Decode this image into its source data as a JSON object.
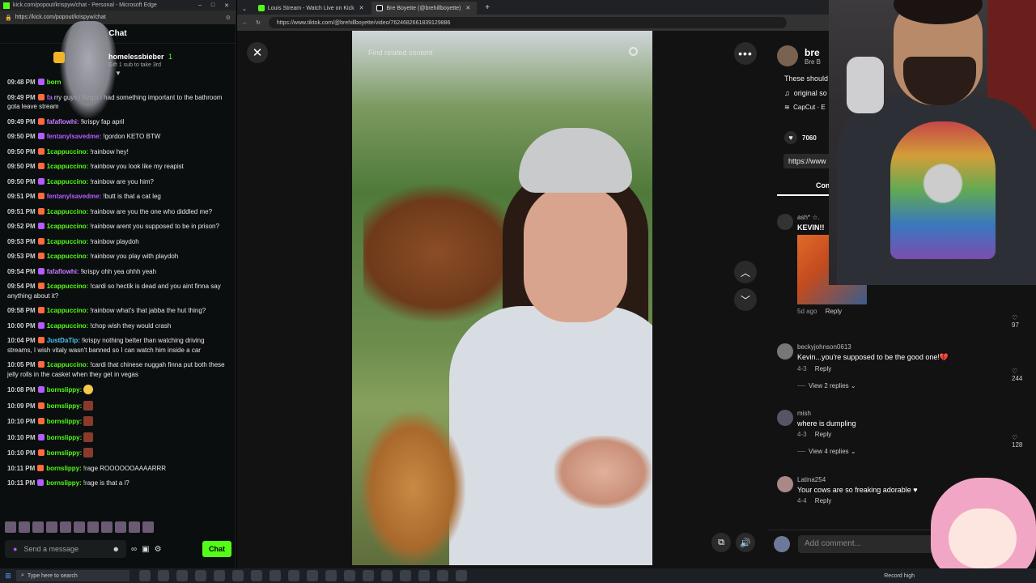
{
  "chat_window": {
    "title": "kick.com/popout/krispyw/chat - Personal - Microsoft Edge",
    "url": "https://kick.com/popout/krispyw/chat",
    "header": "Chat",
    "gift": {
      "user": "homelessbieber",
      "count": "1",
      "subtitle": "Gift 1 sub to take 3rd"
    },
    "messages": [
      {
        "ts": "09:48 PM",
        "user": "born",
        "color": "#53fc18",
        "text": ""
      },
      {
        "ts": "09:49 PM",
        "user": "fa",
        "color": "#b45cff",
        "text": "rry guys i forgot i had something important to the bathroom gota leave stream"
      },
      {
        "ts": "09:49 PM",
        "user": "fafaflowhi:",
        "color": "#c77dff",
        "text": "!krispy fap april"
      },
      {
        "ts": "09:50 PM",
        "user": "fentanylsavedme:",
        "color": "#b45cff",
        "text": "!gordon KETO BTW"
      },
      {
        "ts": "09:50 PM",
        "user": "1cappuccino:",
        "color": "#53fc18",
        "text": "!rainbow hey!"
      },
      {
        "ts": "09:50 PM",
        "user": "1cappuccino:",
        "color": "#53fc18",
        "text": "!rainbow you look like my reapist"
      },
      {
        "ts": "09:50 PM",
        "user": "1cappuccino:",
        "color": "#53fc18",
        "text": "!rainbow are you him?"
      },
      {
        "ts": "09:51 PM",
        "user": "fentanylsavedme:",
        "color": "#b45cff",
        "text": "!butt is that a cat leg"
      },
      {
        "ts": "09:51 PM",
        "user": "1cappuccino:",
        "color": "#53fc18",
        "text": "!rainbow are you the one who diddled me?"
      },
      {
        "ts": "09:52 PM",
        "user": "1cappuccino:",
        "color": "#53fc18",
        "text": "!rainbow arent you supposed to be in prison?"
      },
      {
        "ts": "09:53 PM",
        "user": "1cappuccino:",
        "color": "#53fc18",
        "text": "!rainbow playdoh"
      },
      {
        "ts": "09:53 PM",
        "user": "1cappuccino:",
        "color": "#53fc18",
        "text": "!rainbow you play with playdoh"
      },
      {
        "ts": "09:54 PM",
        "user": "fafaflowhi:",
        "color": "#c77dff",
        "text": "!krispy ohh yea ohhh yeah"
      },
      {
        "ts": "09:54 PM",
        "user": "1cappuccino:",
        "color": "#53fc18",
        "text": "!cardi so hectik is dead and you aint finna say anything about it?"
      },
      {
        "ts": "09:58 PM",
        "user": "1cappuccino:",
        "color": "#53fc18",
        "text": "!rainbow what's that jabba the hut thing?"
      },
      {
        "ts": "10:00 PM",
        "user": "1cappuccino:",
        "color": "#53fc18",
        "text": "!chop wish they would crash"
      },
      {
        "ts": "10:04 PM",
        "user": "JustDaTip:",
        "color": "#4fc3f7",
        "text": "!krispy nothing better than watching driving streams, I wish vitaly wasn't banned so I can watch him inside a car"
      },
      {
        "ts": "10:05 PM",
        "user": "1cappuccino:",
        "color": "#53fc18",
        "text": "!cardi that chinese nuggah finna put both these jelly rolls in the casket when they get in vegas"
      },
      {
        "ts": "10:08 PM",
        "user": "bornslippy:",
        "color": "#53fc18",
        "text": "",
        "emote": "face"
      },
      {
        "ts": "10:09 PM",
        "user": "bornslippy:",
        "color": "#53fc18",
        "text": "",
        "emote": "pic"
      },
      {
        "ts": "10:10 PM",
        "user": "bornslippy:",
        "color": "#53fc18",
        "text": "",
        "emote": "pic"
      },
      {
        "ts": "10:10 PM",
        "user": "bornslippy:",
        "color": "#53fc18",
        "text": "",
        "emote": "pic"
      },
      {
        "ts": "10:10 PM",
        "user": "bornslippy:",
        "color": "#53fc18",
        "text": "",
        "emote": "pic"
      },
      {
        "ts": "10:11 PM",
        "user": "bornslippy:",
        "color": "#53fc18",
        "text": "!rage ROOOOOOAAAARRR"
      },
      {
        "ts": "10:11 PM",
        "user": "bornslippy:",
        "color": "#53fc18",
        "text": "!rage is that a i?"
      }
    ],
    "input_placeholder": "Send a message",
    "send_label": "Chat"
  },
  "browser": {
    "tabs": [
      {
        "label": "Louis Stream - Watch Live on Kick",
        "color": "#53fc18"
      },
      {
        "label": "Bre Boyette (@brehillboyette)",
        "color": "#ffffff"
      }
    ],
    "url": "https://www.tiktok.com/@brehillboyette/video/7624682661839129886"
  },
  "tiktok": {
    "find_related": "Find related content",
    "author_name": "bre",
    "author_nick": "Bre B",
    "description": "These should",
    "music": "original so",
    "capcut": "CapCut · E",
    "likes": "7060",
    "link": "https://www",
    "comments_tab": "Com",
    "comments": [
      {
        "user": "ash* ☆.",
        "text": "KEVIN!!",
        "meta": "5d ago",
        "reply": "Reply",
        "likes": "97",
        "gif": true
      },
      {
        "user": "beckyjohnson0613",
        "text": "Kevin...you're supposed to be the good one!💔",
        "meta": "4-3",
        "reply": "Reply",
        "likes": "244",
        "views": "View 2 replies"
      },
      {
        "user": "mish",
        "text": "where is dumpling",
        "meta": "4-3",
        "reply": "Reply",
        "likes": "128",
        "views": "View 4 replies"
      },
      {
        "user": "Latina254",
        "text": "Your cows are so freaking adorable ♥",
        "meta": "4-4",
        "reply": "Reply",
        "likes": ""
      }
    ],
    "add_comment": "Add comment..."
  },
  "taskbar": {
    "search": "Type here to search",
    "record": "Record high"
  }
}
